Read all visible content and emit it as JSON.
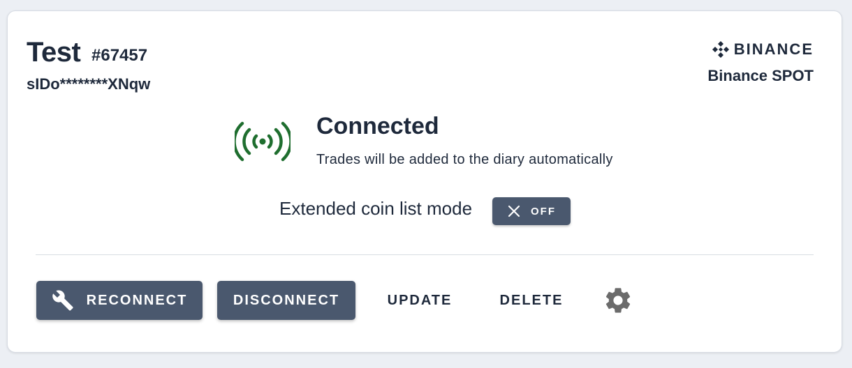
{
  "account": {
    "name": "Test",
    "id": "#67457",
    "api_key_masked": "sIDo********XNqw"
  },
  "exchange": {
    "logo_text": "BINANCE",
    "name": "Binance SPOT",
    "logo_icon": "binance-diamond-icon"
  },
  "status": {
    "title": "Connected",
    "description": "Trades will be added to the diary automatically",
    "icon": "wireless-signal-icon",
    "color": "#1f6e2f"
  },
  "extended_mode": {
    "label": "Extended coin list mode",
    "toggle_text": "OFF",
    "toggle_icon": "close-icon"
  },
  "actions": {
    "reconnect": "RECONNECT",
    "disconnect": "DISCONNECT",
    "update": "UPDATE",
    "delete": "DELETE",
    "reconnect_icon": "wrench-icon",
    "settings_icon": "gear-icon"
  },
  "colors": {
    "accent": "#4a586e",
    "text": "#1e293b",
    "background": "#eceff4"
  }
}
